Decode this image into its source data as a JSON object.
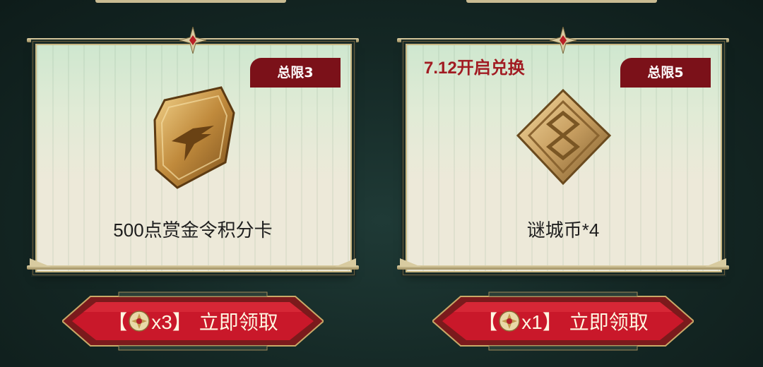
{
  "cards": [
    {
      "limit": "总限3",
      "open_note": "",
      "item_name": "500点赏金令积分卡",
      "item_icon": "bounty-shield-icon",
      "claim": {
        "open": "【",
        "qty": "x3】",
        "action": "立即领取"
      }
    },
    {
      "limit": "总限5",
      "open_note": "7.12开启兑换",
      "item_name": "谜城币*4",
      "item_icon": "mystery-coin-icon",
      "claim": {
        "open": "【",
        "qty": "x1】",
        "action": "立即领取"
      }
    }
  ],
  "colors": {
    "badge": "#7b1119",
    "button": "#c9182a",
    "accent_note": "#a11b22",
    "frame": "#c8b783"
  }
}
